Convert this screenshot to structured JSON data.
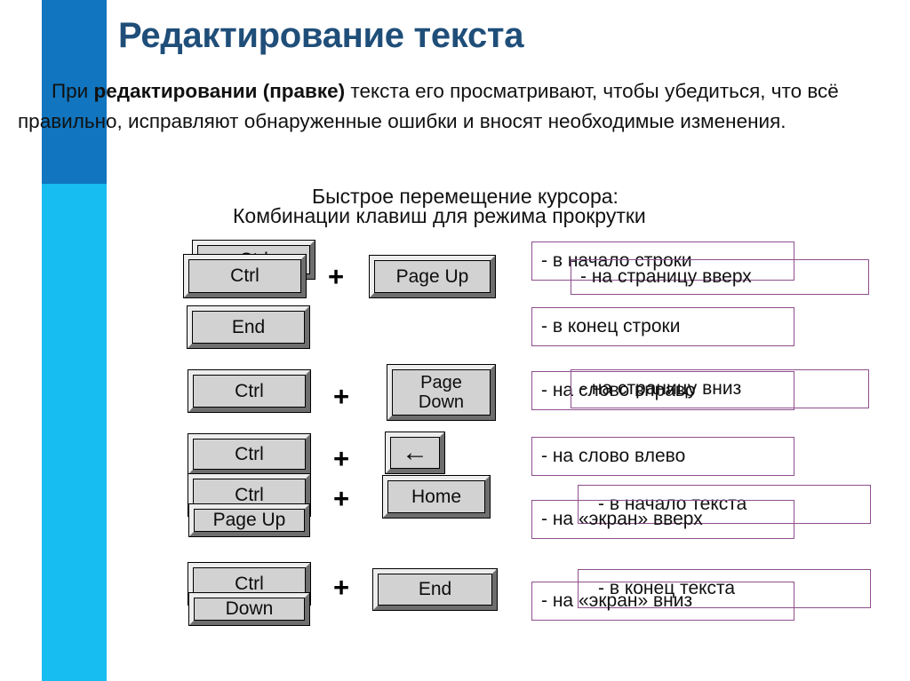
{
  "slide": {
    "title": "Редактирование текста",
    "body": {
      "lead": "При ",
      "bold": "редактировании (правке)",
      "rest": " текста его просматривают, чтобы убедиться, что всё правильно, исправляют обнаруженные ошибки и вносят необходимые изменения."
    },
    "subtitle_a": "Быстрое перемещение курсора:",
    "subtitle_b": "Комбинации клавиш для режима прокрутки",
    "colors": {
      "title": "#1F4E79",
      "bar_top": "#1175BF",
      "bar_bottom": "#17BCF0",
      "desc_border": "#8E4F8E",
      "key_face": "#D2D2D2"
    }
  },
  "keys": [
    {
      "label": "Ctrl",
      "name": "key-ctrl-1"
    },
    {
      "label": "Ctrl",
      "name": "key-ctrl-2"
    },
    {
      "label": "Page Up",
      "name": "key-page-up-1"
    },
    {
      "label": "End",
      "name": "key-end-1"
    },
    {
      "label": "Ctrl",
      "name": "key-ctrl-3"
    },
    {
      "label": "Page\nDown",
      "name": "key-page-down-1"
    },
    {
      "label": "Ctrl",
      "name": "key-ctrl-4"
    },
    {
      "label": "←",
      "name": "key-arrow-left"
    },
    {
      "label": "Ctrl",
      "name": "key-ctrl-5"
    },
    {
      "label": "Home",
      "name": "key-home"
    },
    {
      "label": "Page Up",
      "name": "key-page-up-2"
    },
    {
      "label": "Ctrl",
      "name": "key-ctrl-6"
    },
    {
      "label": "End",
      "name": "key-end-2"
    },
    {
      "label": "Down",
      "name": "key-page-down-2"
    }
  ],
  "key_labels": {
    "ctrl": "Ctrl",
    "page_up": "Page Up",
    "page_down_line1": "Page",
    "page_down_line2": "Down",
    "end": "End",
    "home": "Home",
    "arrow_left": "←",
    "down": "Down",
    "plus": "+"
  },
  "descriptions": [
    {
      "text": "- в начало строки",
      "name": "desc-line-start"
    },
    {
      "text": "- на страницу вверх",
      "name": "desc-page-up"
    },
    {
      "text": "- в конец строки",
      "name": "desc-line-end"
    },
    {
      "text": "- на слово вправо",
      "name": "desc-word-right"
    },
    {
      "text": "- на страницу вниз",
      "name": "desc-page-down"
    },
    {
      "text": "- на слово влево",
      "name": "desc-word-left"
    },
    {
      "text": "- в  начало текста",
      "name": "desc-text-start"
    },
    {
      "text": "- на «экран» вверх",
      "name": "desc-screen-up"
    },
    {
      "text": "- в конец текста",
      "name": "desc-text-end"
    },
    {
      "text": "- на «экран» вниз",
      "name": "desc-screen-down"
    }
  ]
}
